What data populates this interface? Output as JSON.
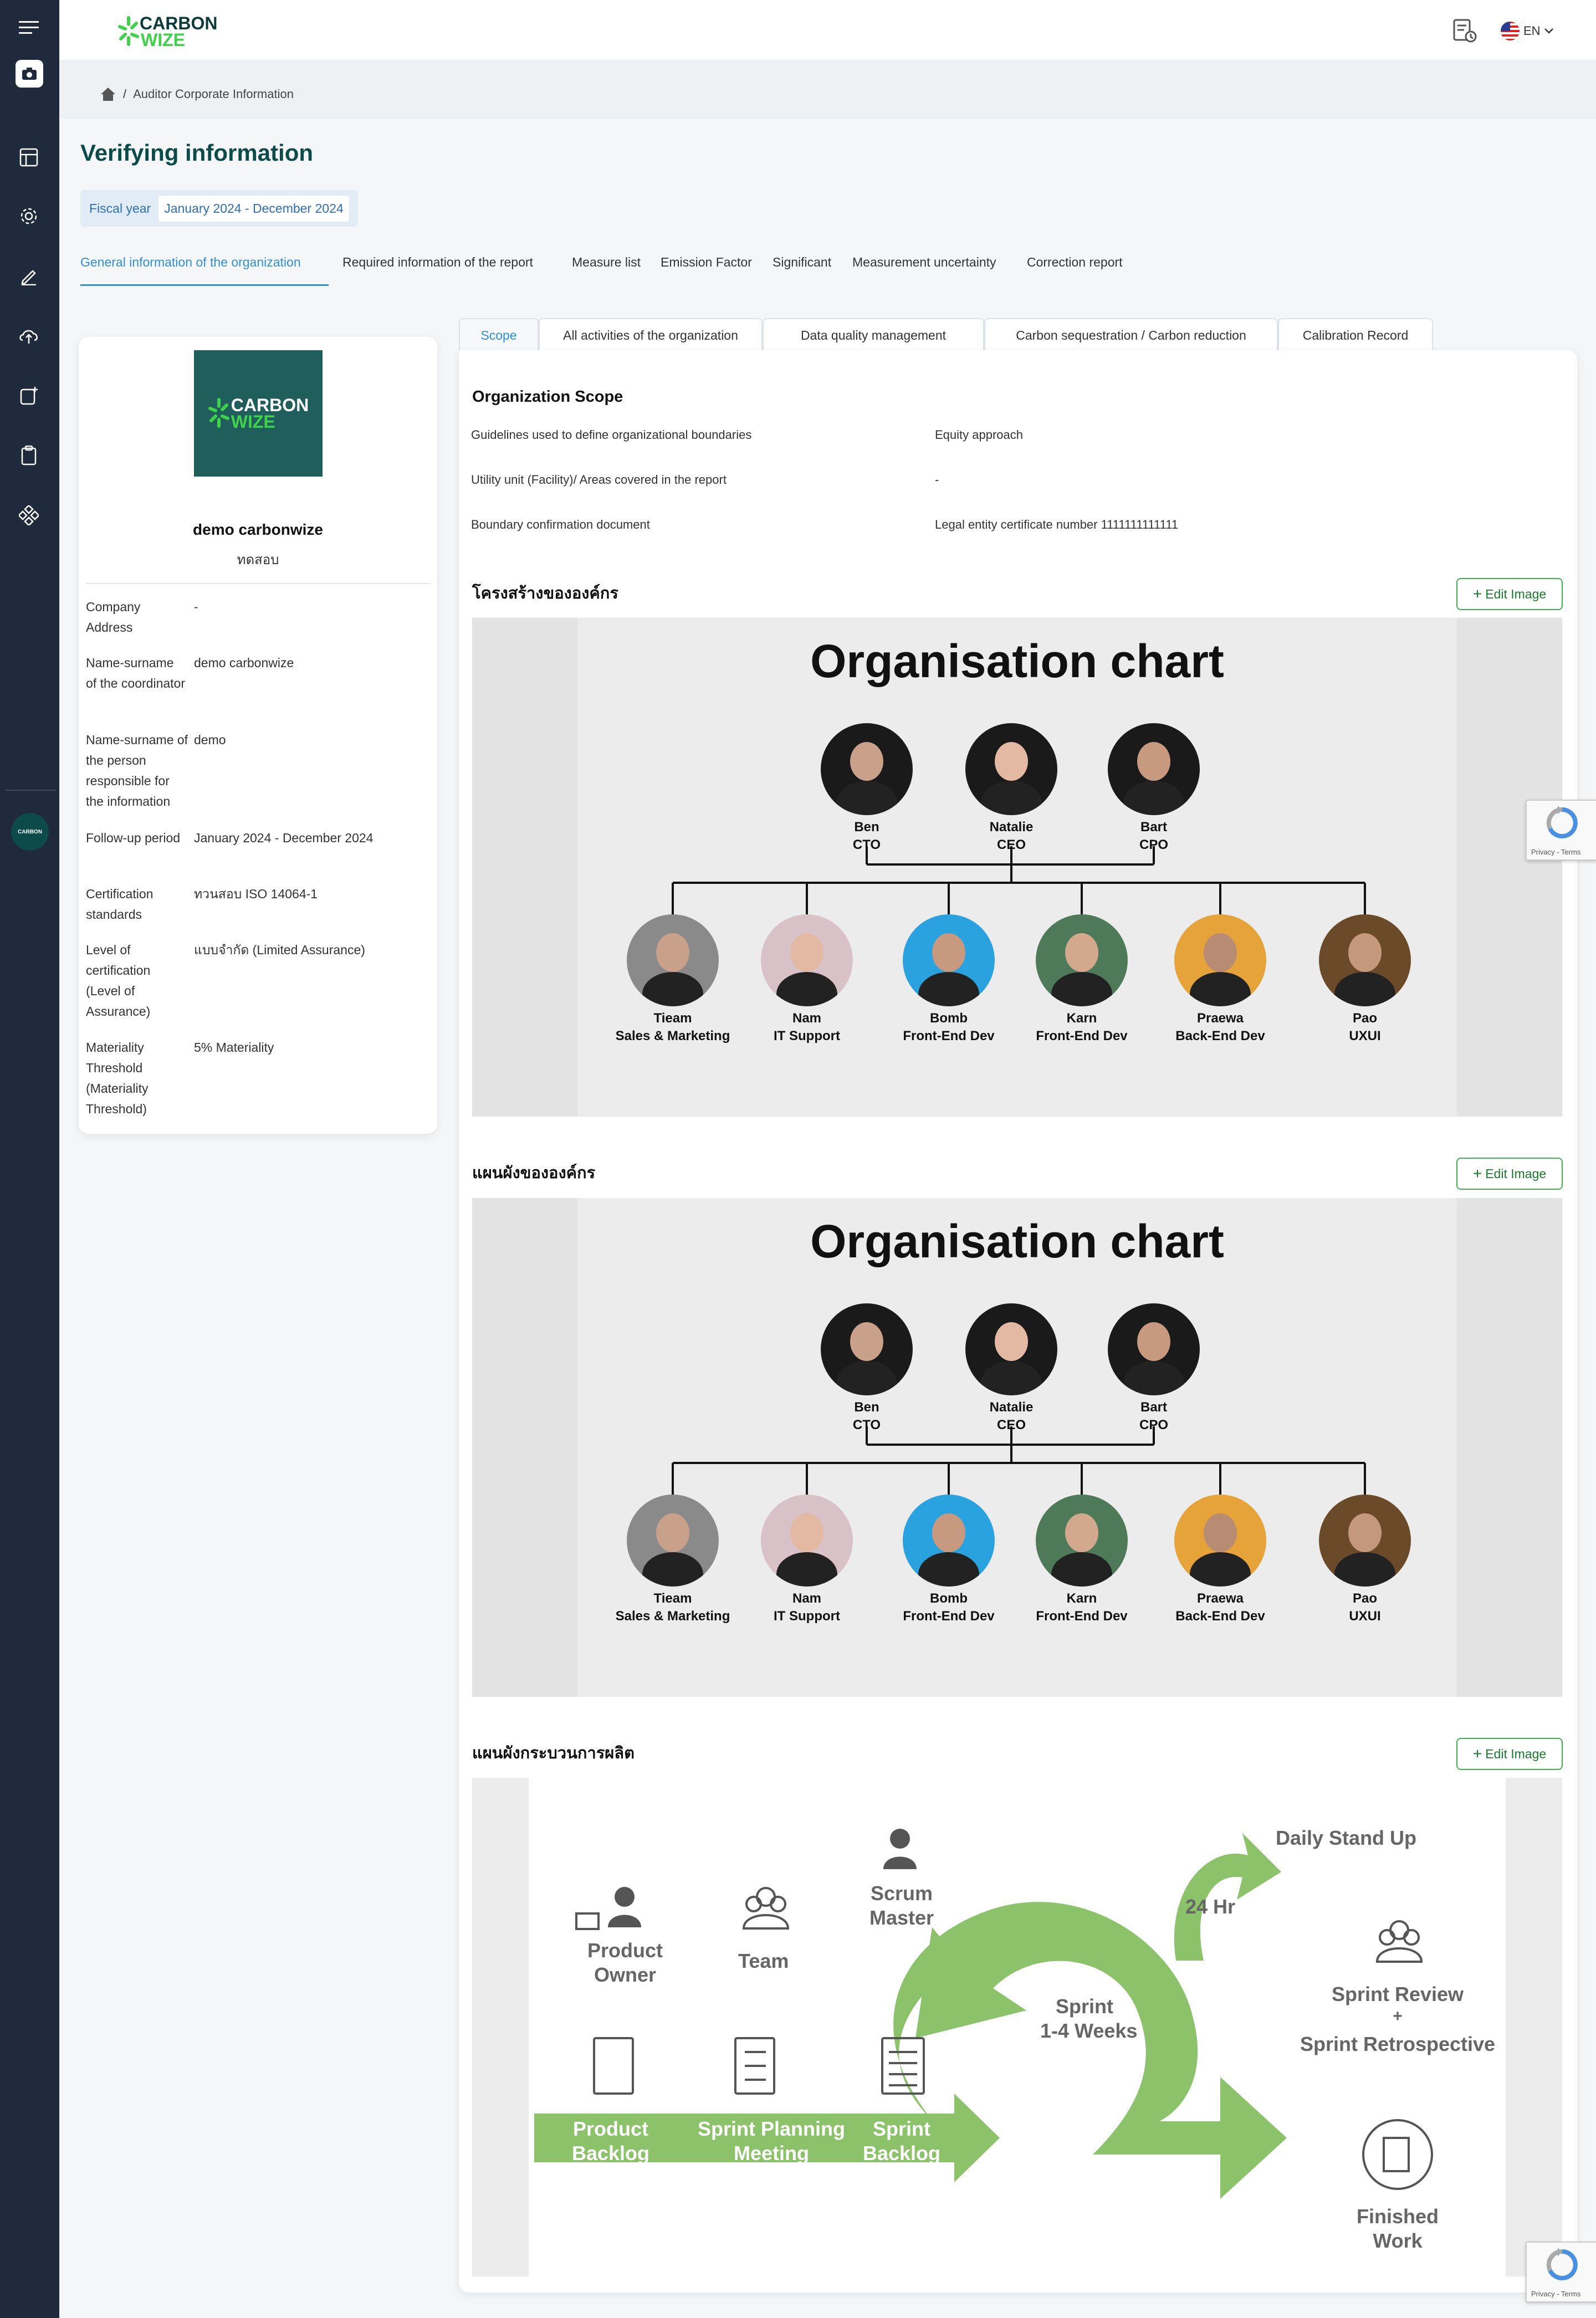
{
  "brand": {
    "line1": "CARBON",
    "line2": "WIZE"
  },
  "header": {
    "lang": "EN"
  },
  "breadcrumb": {
    "current": "Auditor Corporate Information"
  },
  "page": {
    "title": "Verifying information",
    "fiscal_label": "Fiscal year",
    "fiscal_value": "January 2024 - December 2024"
  },
  "main_tabs": [
    "General information of the organization",
    "Required information of the report",
    "Measure list",
    "Emission Factor",
    "Significant",
    "Measurement uncertainty",
    "Correction report"
  ],
  "sub_tabs": [
    "Scope",
    "All activities of the organization",
    "Data quality management",
    "Carbon sequestration / Carbon reduction",
    "Calibration Record"
  ],
  "profile": {
    "logo_line1": "CARBON",
    "logo_line2": "WIZE",
    "company": "demo carbonwize",
    "subtitle": "ทดสอบ",
    "fields": [
      {
        "label": "Company Address",
        "value": "-"
      },
      {
        "label": "Name-surname of the coordinator",
        "value": "demo carbonwize"
      },
      {
        "label": "Name-surname of the person responsible for the information",
        "value": "demo"
      },
      {
        "label": "Follow-up period",
        "value": "January 2024 - December 2024"
      },
      {
        "label": "Certification standards",
        "value": "ทวนสอบ ISO 14064-1"
      },
      {
        "label": "Level of certification (Level of Assurance)",
        "value": "แบบจำกัด (Limited Assurance)"
      },
      {
        "label": "Materiality Threshold (Materiality Threshold)",
        "value": "5% Materiality"
      }
    ]
  },
  "scope": {
    "heading": "Organization Scope",
    "rows": [
      {
        "label": "Guidelines used to define organizational boundaries",
        "value": "Equity approach"
      },
      {
        "label": "Utility unit (Facility)/ Areas covered in the report",
        "value": "-"
      },
      {
        "label": "Boundary confirmation document",
        "value": "Legal entity certificate number 1111111111111"
      }
    ]
  },
  "sections": [
    {
      "title": "โครงสร้างขององค์กร",
      "button": "Edit Image"
    },
    {
      "title": "แผนผังขององค์กร",
      "button": "Edit Image"
    },
    {
      "title": "แผนผังกระบวนการผลิต",
      "button": "Edit Image"
    }
  ],
  "org_chart": {
    "title": "Organisation chart",
    "top": [
      {
        "name": "Ben",
        "role": "CTO"
      },
      {
        "name": "Natalie",
        "role": "CEO"
      },
      {
        "name": "Bart",
        "role": "CPO"
      }
    ],
    "bottom": [
      {
        "name": "Tieam",
        "role": "Sales & Marketing"
      },
      {
        "name": "Nam",
        "role": "IT Support"
      },
      {
        "name": "Bomb",
        "role": "Front-End Dev"
      },
      {
        "name": "Karn",
        "role": "Front-End Dev"
      },
      {
        "name": "Praewa",
        "role": "Back-End Dev"
      },
      {
        "name": "Pao",
        "role": "UXUI"
      }
    ]
  },
  "process": {
    "product_owner": "Product Owner",
    "team": "Team",
    "scrum_master": "Scrum Master",
    "daily": "Daily Stand Up",
    "hours": "24 Hr",
    "sprint": "Sprint",
    "sprint_weeks": "1-4 Weeks",
    "review": "Sprint Review",
    "plus": "+",
    "retro": "Sprint Retrospective",
    "product_backlog": "Product Backlog",
    "planning": "Sprint Planning Meeting",
    "sprint_backlog": "Sprint Backlog",
    "finished": "Finished Work"
  },
  "recaptcha": {
    "caption": "Privacy - Terms"
  },
  "colors": {
    "sidebar": "#1f2a3c",
    "accent_green": "#3fb14c",
    "title_teal": "#0d4b4b",
    "link_blue": "#2f8fd8",
    "arrow_green": "#8cc26a"
  }
}
